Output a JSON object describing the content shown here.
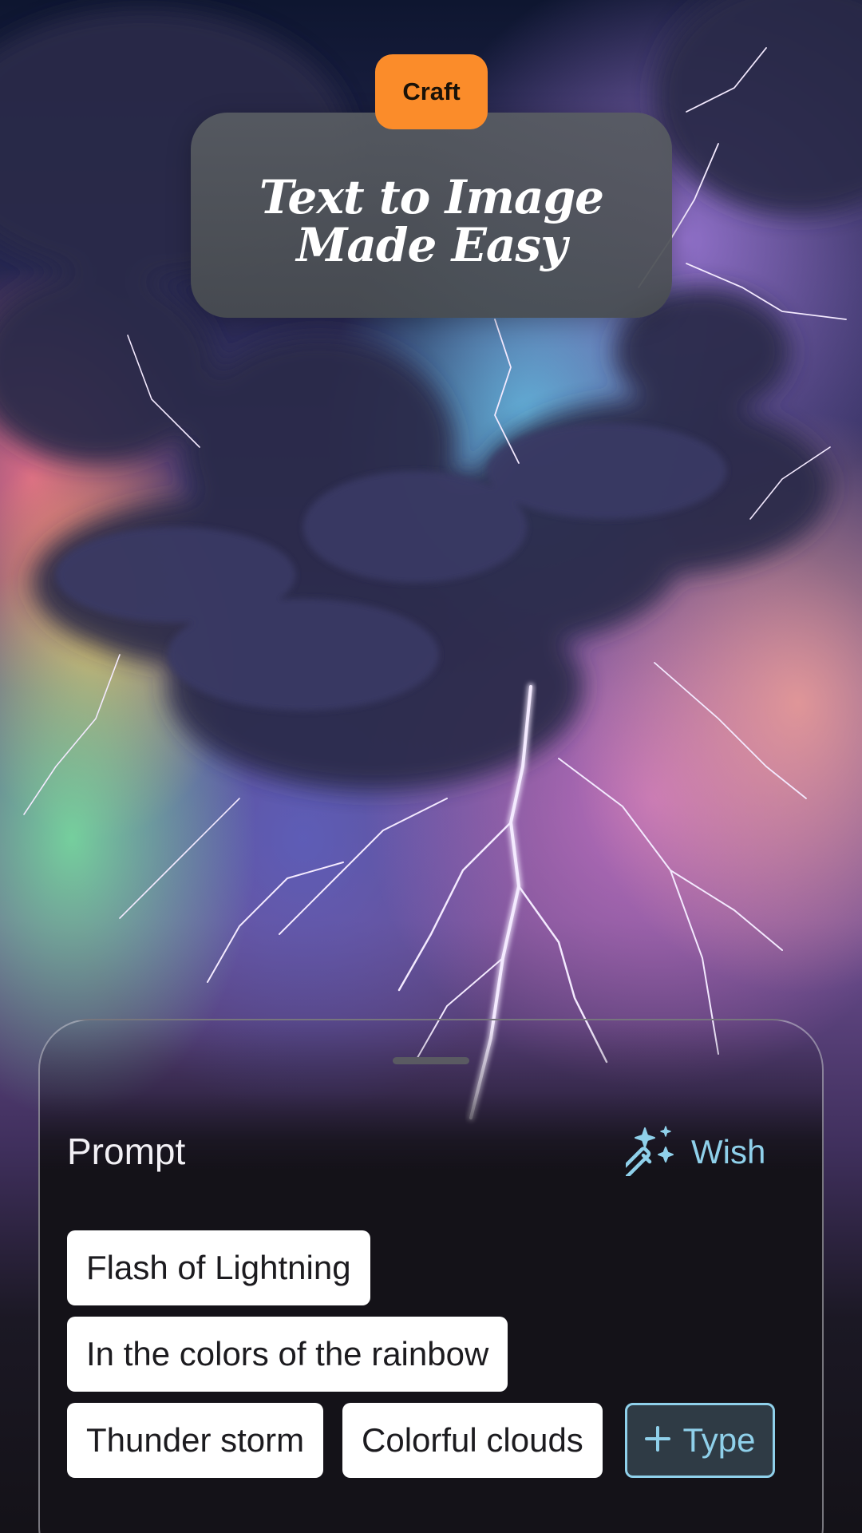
{
  "header": {
    "badge_label": "Craft",
    "title": "Text to Image Made Easy"
  },
  "prompt_panel": {
    "title": "Prompt",
    "wish_label": "Wish",
    "wish_icon": "magic-wand-sparkles-icon",
    "chips": [
      "Flash of Lightning",
      "In the colors of the rainbow",
      "Thunder storm",
      "Colorful clouds"
    ],
    "add_label": "Type",
    "add_icon": "plus-icon"
  },
  "colors": {
    "badge": "#fb8c2a",
    "accent": "#8fd0ea",
    "sheet_background": "#141218",
    "chip_background": "#ffffff"
  }
}
